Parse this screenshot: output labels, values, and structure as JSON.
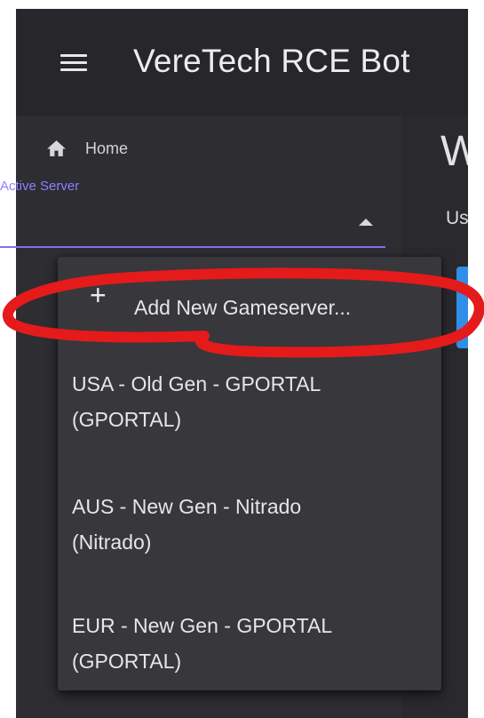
{
  "app": {
    "title": "VereTech RCE Bot",
    "menu_icon": "hamburger-menu-icon"
  },
  "sidebar": {
    "home": {
      "icon": "home-icon",
      "label": "Home"
    },
    "active_server": {
      "label": "Active Server",
      "value": "",
      "caret_icon": "caret-up-icon"
    }
  },
  "main": {
    "title": "W",
    "subtitle": "Use"
  },
  "dropdown": {
    "items": [
      {
        "icon": "plus-icon",
        "label": "Add New Gameserver..."
      },
      {
        "label_lines": [
          "USA - Old Gen - GPORTAL",
          "(GPORTAL)"
        ]
      },
      {
        "label_lines": [
          "AUS - New Gen - Nitrado",
          "(Nitrado)"
        ]
      },
      {
        "label_lines": [
          "EUR - New Gen - GPORTAL",
          "(GPORTAL)"
        ]
      }
    ]
  },
  "colors": {
    "accent": "#7d73f0",
    "accent_label": "#8b80ff",
    "button_blue": "#2f8fe8",
    "annotation_red": "#e51a1a",
    "appbar_bg": "#27272b",
    "menu_bg": "#37373c"
  }
}
